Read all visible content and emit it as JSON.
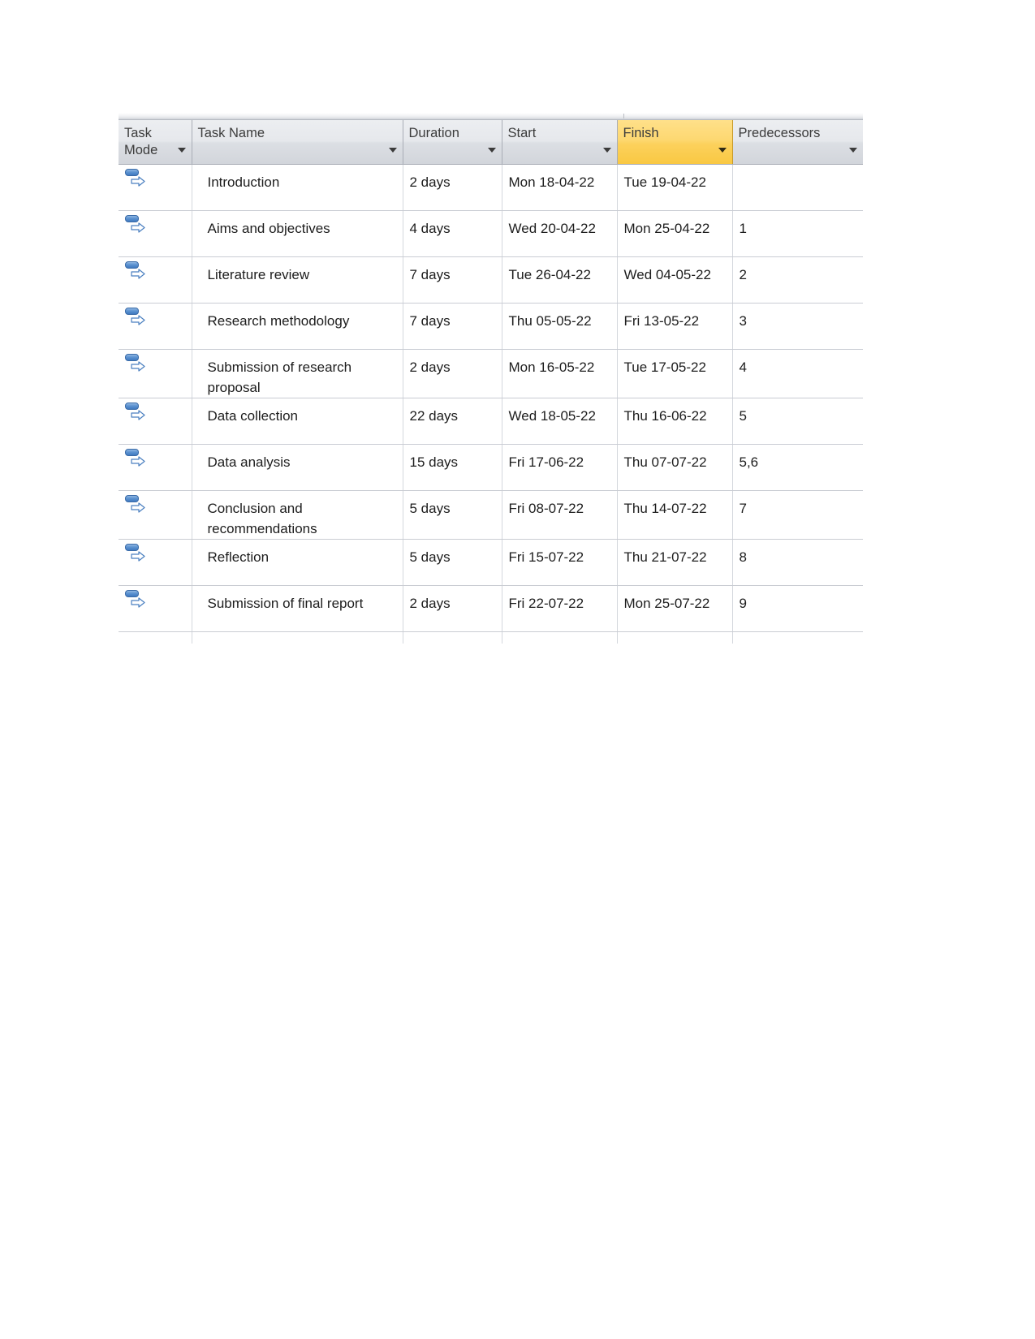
{
  "grid": {
    "columns": [
      {
        "key": "task_mode",
        "label": "Task Mode",
        "highlighted": false,
        "has_filter": true
      },
      {
        "key": "task_name",
        "label": "Task Name",
        "highlighted": false,
        "has_filter": true
      },
      {
        "key": "duration",
        "label": "Duration",
        "highlighted": false,
        "has_filter": true
      },
      {
        "key": "start",
        "label": "Start",
        "highlighted": false,
        "has_filter": true
      },
      {
        "key": "finish",
        "label": "Finish",
        "highlighted": true,
        "has_filter": true
      },
      {
        "key": "predecessors",
        "label": "Predecessors",
        "highlighted": false,
        "has_filter": true
      }
    ],
    "task_mode_icon": "manually-scheduled-icon",
    "rows": [
      {
        "task_mode": "manually-scheduled-icon",
        "task_name": "Introduction",
        "duration": "2 days",
        "start": "Mon 18-04-22",
        "finish": "Tue 19-04-22",
        "predecessors": ""
      },
      {
        "task_mode": "manually-scheduled-icon",
        "task_name": "Aims and objectives",
        "duration": "4 days",
        "start": "Wed 20-04-22",
        "finish": "Mon 25-04-22",
        "predecessors": "1"
      },
      {
        "task_mode": "manually-scheduled-icon",
        "task_name": "Literature review",
        "duration": "7 days",
        "start": "Tue 26-04-22",
        "finish": "Wed 04-05-22",
        "predecessors": "2"
      },
      {
        "task_mode": "manually-scheduled-icon",
        "task_name": "Research methodology",
        "duration": "7 days",
        "start": "Thu 05-05-22",
        "finish": "Fri 13-05-22",
        "predecessors": "3"
      },
      {
        "task_mode": "manually-scheduled-icon",
        "task_name": "Submission of research proposal",
        "duration": "2 days",
        "start": "Mon 16-05-22",
        "finish": "Tue 17-05-22",
        "predecessors": "4"
      },
      {
        "task_mode": "manually-scheduled-icon",
        "task_name": "Data collection",
        "duration": "22 days",
        "start": "Wed 18-05-22",
        "finish": "Thu 16-06-22",
        "predecessors": "5"
      },
      {
        "task_mode": "manually-scheduled-icon",
        "task_name": "Data analysis",
        "duration": "15 days",
        "start": "Fri 17-06-22",
        "finish": "Thu 07-07-22",
        "predecessors": "5,6"
      },
      {
        "task_mode": "manually-scheduled-icon",
        "task_name": "Conclusion and recommendations",
        "duration": "5 days",
        "start": "Fri 08-07-22",
        "finish": "Thu 14-07-22",
        "predecessors": "7"
      },
      {
        "task_mode": "manually-scheduled-icon",
        "task_name": "Reflection",
        "duration": "5 days",
        "start": "Fri 15-07-22",
        "finish": "Thu 21-07-22",
        "predecessors": "8"
      },
      {
        "task_mode": "manually-scheduled-icon",
        "task_name": "Submission of final report",
        "duration": "2 days",
        "start": "Fri 22-07-22",
        "finish": "Mon 25-07-22",
        "predecessors": "9"
      }
    ]
  },
  "colors": {
    "header_background": "#dcdfe4",
    "header_highlight": "#fcd15c",
    "header_text": "#3c3c3c",
    "cell_text": "#1d1d1d",
    "grid_line": "#c9ccd3",
    "icon_blue": "#3f79c0",
    "page_background": "#ffffff"
  }
}
